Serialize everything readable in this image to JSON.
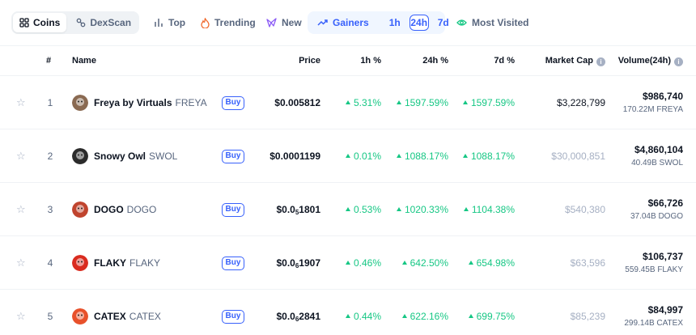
{
  "filters": {
    "coins_label": "Coins",
    "dexscan_label": "DexScan",
    "top_label": "Top",
    "trending_label": "Trending",
    "new_label": "New",
    "gainers_label": "Gainers",
    "time_options": [
      "1h",
      "24h",
      "7d"
    ],
    "time_selected": "24h",
    "most_visited_label": "Most Visited"
  },
  "columns": {
    "rank": "#",
    "name": "Name",
    "price": "Price",
    "change_1h": "1h %",
    "change_24h": "24h %",
    "change_7d": "7d %",
    "market_cap": "Market Cap",
    "volume": "Volume(24h)"
  },
  "buy_label": "Buy",
  "rows": [
    {
      "rank": "1",
      "name": "Freya by Virtuals",
      "symbol": "FREYA",
      "price_main": "$0.005812",
      "price_sub": "",
      "price_tail": "",
      "change_1h": "5.31%",
      "change_24h": "1597.59%",
      "change_7d": "1597.59%",
      "market_cap": "$3,228,799",
      "market_cap_color": "#0d1421",
      "volume": "$986,740",
      "volume_sub": "170.22M FREYA",
      "logo_color": "#8a6a52"
    },
    {
      "rank": "2",
      "name": "Snowy Owl",
      "symbol": "SWOL",
      "price_main": "$0.0001199",
      "price_sub": "",
      "price_tail": "",
      "change_1h": "0.01%",
      "change_24h": "1088.17%",
      "change_7d": "1088.17%",
      "market_cap": "$30,000,851",
      "market_cap_color": "#a6b0c3",
      "volume": "$4,860,104",
      "volume_sub": "40.49B SWOL",
      "logo_color": "#2b2b2b"
    },
    {
      "rank": "3",
      "name": "DOGO",
      "symbol": "DOGO",
      "price_main": "$0.0",
      "price_sub": "5",
      "price_tail": "1801",
      "change_1h": "0.53%",
      "change_24h": "1020.33%",
      "change_7d": "1104.38%",
      "market_cap": "$540,380",
      "market_cap_color": "#a6b0c3",
      "volume": "$66,726",
      "volume_sub": "37.04B DOGO",
      "logo_color": "#c0442e"
    },
    {
      "rank": "4",
      "name": "FLAKY",
      "symbol": "FLAKY",
      "price_main": "$0.0",
      "price_sub": "6",
      "price_tail": "1907",
      "change_1h": "0.46%",
      "change_24h": "642.50%",
      "change_7d": "654.98%",
      "market_cap": "$63,596",
      "market_cap_color": "#a6b0c3",
      "volume": "$106,737",
      "volume_sub": "559.45B FLAKY",
      "logo_color": "#d92b1f"
    },
    {
      "rank": "5",
      "name": "CATEX",
      "symbol": "CATEX",
      "price_main": "$0.0",
      "price_sub": "6",
      "price_tail": "2841",
      "change_1h": "0.44%",
      "change_24h": "622.16%",
      "change_7d": "699.75%",
      "market_cap": "$85,239",
      "market_cap_color": "#a6b0c3",
      "volume": "$84,997",
      "volume_sub": "299.14B CATEX",
      "logo_color": "#e8512b"
    }
  ]
}
